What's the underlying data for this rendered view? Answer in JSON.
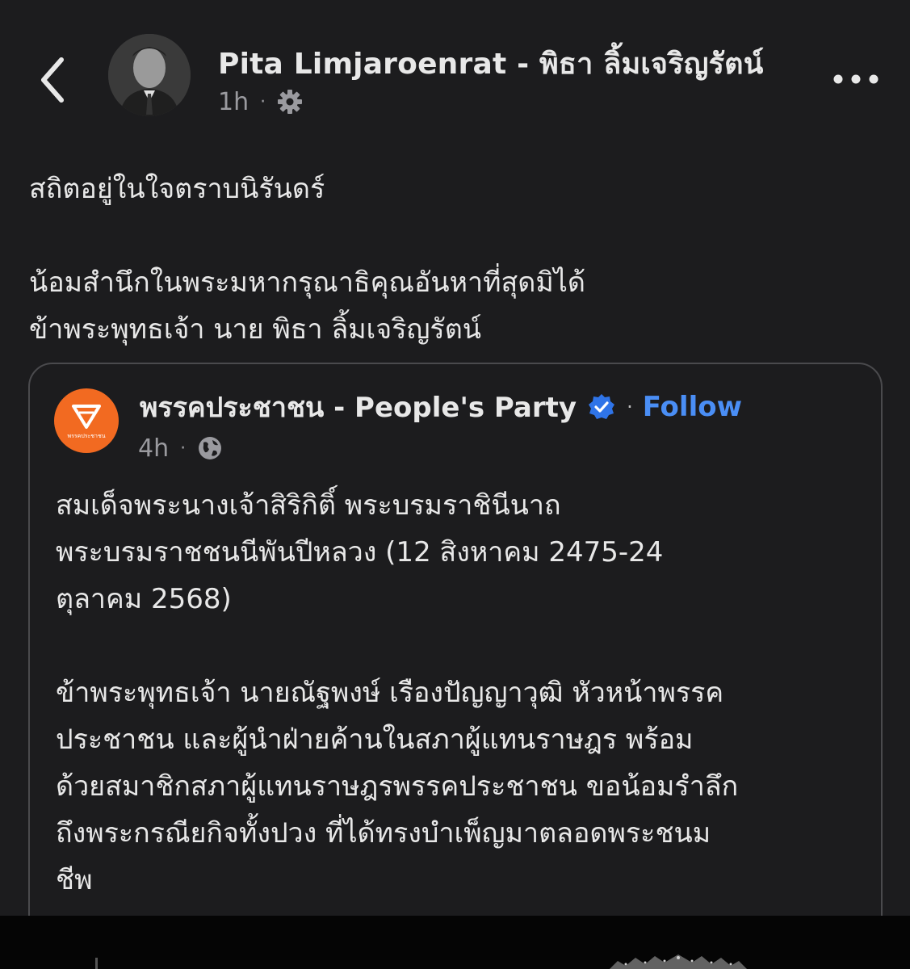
{
  "header": {
    "author_name": "Pita Limjaroenrat - พิธา ลิ้มเจริญรัตน์",
    "time": "1h",
    "dot": "·",
    "audience_icon": "gear-icon",
    "back_icon": "chevron-left-icon",
    "more_icon": "more-horizontal-icon"
  },
  "post": {
    "lines": [
      "สถิตอยู่ในใจตราบนิรันดร์",
      "",
      "น้อมสำนึกในพระมหากรุณาธิคุณอันหาที่สุดมิได้",
      "ข้าพระพุทธเจ้า นาย พิธา ลิ้มเจริญรัตน์"
    ]
  },
  "shared": {
    "page_name": "พรรคประชาชน - People's Party",
    "verified_icon": "verified-badge-icon",
    "dot": "·",
    "follow_label": "Follow",
    "time": "4h",
    "audience_icon": "globe-icon",
    "logo_caption": "พรรคประชาชน",
    "logo_color": "#f26a21",
    "paragraph1": [
      "สมเด็จพระนางเจ้าสิริกิติ์ พระบรมราชินีนาถ",
      "พระบรมราชชนนีพันปีหลวง (12 สิงหาคม 2475-24",
      "ตุลาคม 2568)"
    ],
    "paragraph2": [
      "ข้าพระพุทธเจ้า นายณัฐพงษ์ เรืองปัญญาวุฒิ หัวหน้าพรรค",
      "ประชาชน และผู้นำฝ่ายค้านในสภาผู้แทนราษฎร พร้อม",
      "ด้วยสมาชิกสภาผู้แทนราษฎรพรรคประชาชน ขอน้อมรำลึก",
      "ถึงพระกรณียกิจทั้งปวง ที่ได้ทรงบำเพ็ญมาตลอดพระชนม",
      "ชีพ"
    ]
  },
  "colors": {
    "background": "#1c1c1e",
    "text": "#e8e8e8",
    "secondary_text": "#9a9a9f",
    "link": "#4a8ef5",
    "card_border": "#4a4a4d"
  }
}
